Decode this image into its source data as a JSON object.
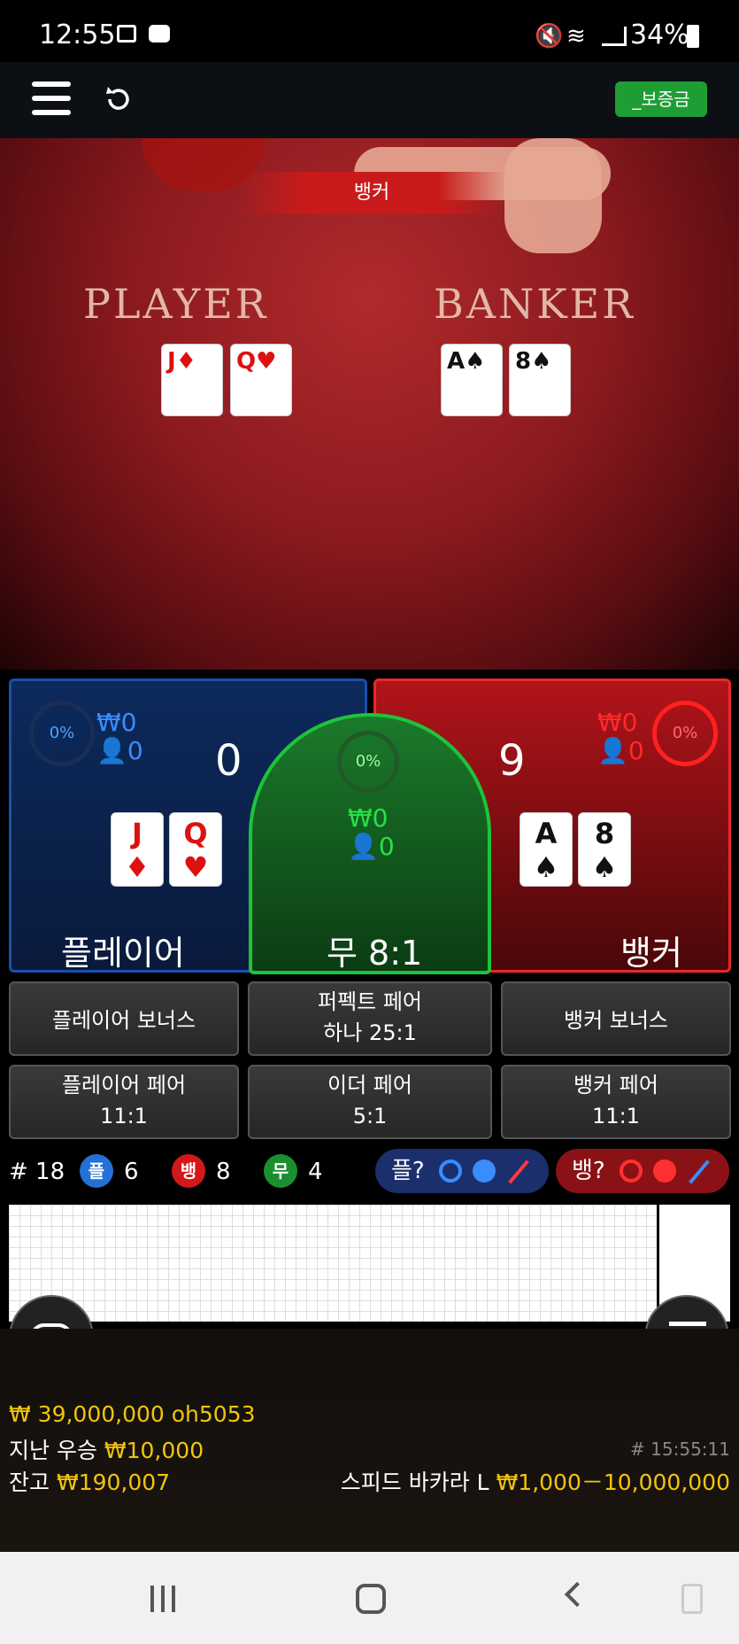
{
  "status_bar": {
    "time": "12:55",
    "battery": "34%"
  },
  "header": {
    "deposit_label": "_보증금"
  },
  "video": {
    "result_banner": "뱅커",
    "player_label": "PLAYER",
    "banker_label": "BANKER",
    "player_cards": [
      {
        "rank": "J",
        "suit": "♦"
      },
      {
        "rank": "Q",
        "suit": "♥"
      }
    ],
    "banker_cards": [
      {
        "rank": "A",
        "suit": "♠"
      },
      {
        "rank": "8",
        "suit": "♠"
      }
    ]
  },
  "bets": {
    "player": {
      "percent": "0%",
      "amount": "₩0",
      "users": "0",
      "score": "0",
      "label": "플레이어",
      "cards": [
        {
          "rank": "J",
          "suit": "♦"
        },
        {
          "rank": "Q",
          "suit": "♥"
        }
      ]
    },
    "tie": {
      "percent": "0%",
      "amount": "₩0",
      "users": "0",
      "label": "무 8:1"
    },
    "banker": {
      "percent": "0%",
      "amount": "₩0",
      "users": "0",
      "score": "9",
      "label": "뱅커",
      "cards": [
        {
          "rank": "A",
          "suit": "♠"
        },
        {
          "rank": "8",
          "suit": "♠"
        }
      ]
    }
  },
  "side_bets": {
    "player_bonus": "플레이어 보너스",
    "perfect_pair_1": "퍼펙트 페어",
    "perfect_pair_2": "하나 25:1",
    "banker_bonus": "뱅커 보너스",
    "player_pair_1": "플레이어 페어",
    "player_pair_2": "11:1",
    "either_pair_1": "이더 페어",
    "either_pair_2": "5:1",
    "banker_pair_1": "뱅커 페어",
    "banker_pair_2": "11:1"
  },
  "stats": {
    "round": "# 18",
    "player_badge": "플",
    "player_count": "6",
    "banker_badge": "뱅",
    "banker_count": "8",
    "tie_badge": "무",
    "tie_count": "4",
    "player_predict": "플?",
    "banker_predict": "뱅?"
  },
  "footer": {
    "jackpot": "₩ 39,000,000 oh5053",
    "last_win_label": "지난 우승",
    "last_win_value": "₩10,000",
    "balance_label": "잔고",
    "balance_value": "₩190,007",
    "round_time": "# 15:55:11",
    "table_name": "스피드 바카라 L",
    "limits": "₩1,000－10,000,000"
  },
  "colors": {
    "player": "#1d4fa8",
    "banker": "#e82929",
    "tie": "#1ec33a",
    "gold": "#f2c40b"
  }
}
